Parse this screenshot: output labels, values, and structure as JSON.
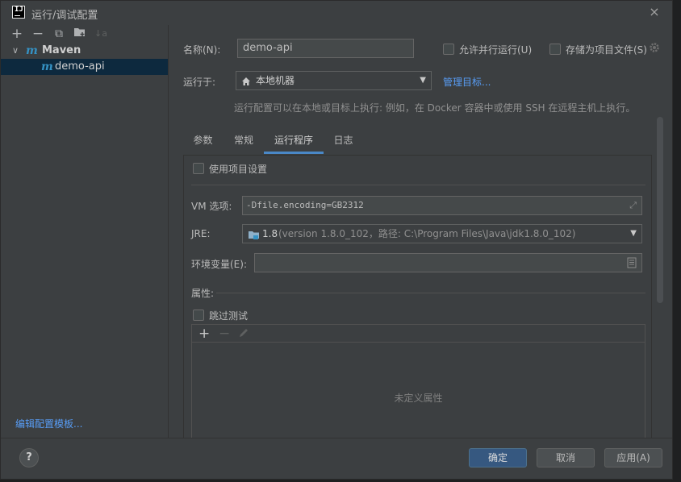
{
  "window": {
    "app_icon": "IJ",
    "title": "运行/调试配置",
    "close_icon": "×"
  },
  "left": {
    "toolbar": [
      "+",
      "−",
      "⧉",
      "📁",
      "↓a"
    ],
    "tree": [
      {
        "label": "Maven",
        "icon": "maven-m",
        "expanded": true
      },
      {
        "label": "demo-api",
        "icon": "maven-m",
        "selected": true
      }
    ],
    "edit_templates_link": "编辑配置模板..."
  },
  "form": {
    "name_label": "名称(N):",
    "name_value": "demo-api",
    "allow_parallel_label": "允许并行运行(U)",
    "store_as_project_file_label": "存储为项目文件(S)",
    "run_on_label": "运行于:",
    "run_on_value": "本地机器",
    "manage_targets_link": "管理目标...",
    "run_on_hint": "运行配置可以在本地或目标上执行: 例如，在 Docker 容器中或使用 SSH 在远程主机上执行。"
  },
  "tabs": [
    {
      "label": "参数",
      "active": false
    },
    {
      "label": "常规",
      "active": false
    },
    {
      "label": "运行程序",
      "active": true
    },
    {
      "label": "日志",
      "active": false
    }
  ],
  "runner": {
    "use_project_settings_label": "使用项目设置",
    "vm_options_label": "VM 选项:",
    "vm_options_value": "-Dfile.encoding=GB2312",
    "jre_label": "JRE:",
    "jre_version": "1.8",
    "jre_detail": "(version 1.8.0_102，路径: C:\\Program Files\\Java\\jdk1.8.0_102)",
    "env_vars_label": "环境变量(E):",
    "env_vars_value": "",
    "properties_label": "属性:",
    "skip_tests_label": "跳过测试",
    "props_empty_text": "未定义属性"
  },
  "buttons": {
    "help": "?",
    "ok": "确定",
    "cancel": "取消",
    "apply": "应用(A)"
  },
  "colors": {
    "background": "#3c3f41",
    "selection": "#0d293e",
    "link": "#589df6",
    "primary_button": "#365880",
    "active_tab_underline": "#4a88c7",
    "maven_icon": "#3592c4"
  }
}
